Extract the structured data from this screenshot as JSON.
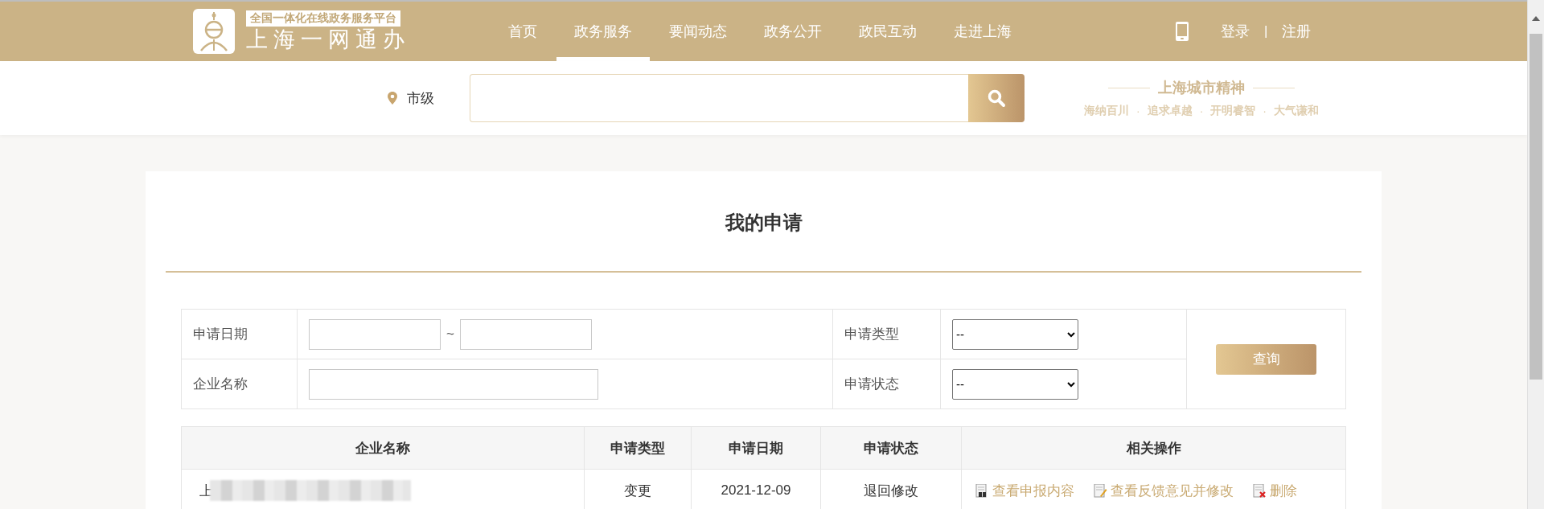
{
  "logo": {
    "tagline": "全国一体化在线政务服务平台",
    "name": "上海一网通办"
  },
  "nav": [
    {
      "label": "首页",
      "selected": false
    },
    {
      "label": "政务服务",
      "selected": true
    },
    {
      "label": "要闻动态",
      "selected": false
    },
    {
      "label": "政务公开",
      "selected": false
    },
    {
      "label": "政民互动",
      "selected": false
    },
    {
      "label": "走进上海",
      "selected": false
    }
  ],
  "account": {
    "login": "登录",
    "separator": "|",
    "register": "注册"
  },
  "location": "市级",
  "slogan": {
    "title": "上海城市精神",
    "values": [
      "海纳百川",
      "追求卓越",
      "开明睿智",
      "大气谦和"
    ],
    "dot": "·"
  },
  "page_title": "我的申请",
  "filters": {
    "date_label": "申请日期",
    "date_separator": "~",
    "company_label": "企业名称",
    "type_label": "申请类型",
    "type_value": "--",
    "status_label": "申请状态",
    "status_value": "--",
    "query_button": "查询"
  },
  "table": {
    "columns": [
      "企业名称",
      "申请类型",
      "申请日期",
      "申请状态",
      "相关操作"
    ],
    "rows": [
      {
        "company": "上",
        "redacted": true,
        "type": "变更",
        "date": "2021-12-09",
        "status": "退回修改",
        "actions": [
          {
            "kind": "view",
            "label": "查看申报内容"
          },
          {
            "kind": "edit",
            "label": "查看反馈意见并修改"
          },
          {
            "kind": "delete",
            "label": "删除"
          }
        ]
      }
    ]
  }
}
